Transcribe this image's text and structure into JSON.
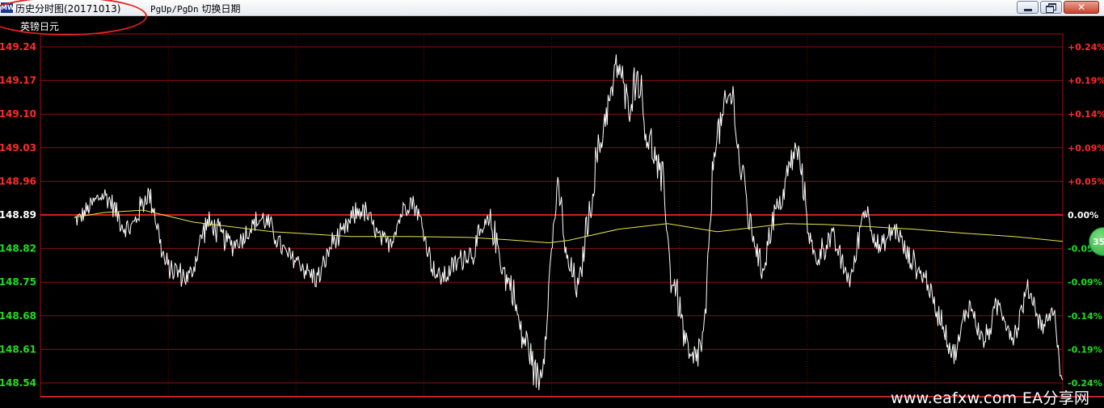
{
  "window": {
    "icon_label": "MW",
    "title": "历史分时图(20171013)",
    "hint_keys": "PgUp/PgDn",
    "hint_text": "切换日期",
    "minimize_icon": "minimize-icon",
    "restore_icon": "restore-icon",
    "close_label": "✕"
  },
  "symbol": "英镑日元",
  "colors": {
    "up": "#ff2a2a",
    "down": "#22dd22",
    "zero": "#ffffff",
    "grid": "#8b0000",
    "price": "#ffffff",
    "avg": "#e6e650"
  },
  "badge": {
    "label": "35"
  },
  "watermark": "www.eafxw.com  EA分享网",
  "chart_data": {
    "type": "line",
    "ylim": [
      148.52,
      149.26
    ],
    "base_price": 148.89,
    "y_ticks_left": [
      {
        "value": 149.24,
        "label": "149.24"
      },
      {
        "value": 149.17,
        "label": "149.17"
      },
      {
        "value": 149.1,
        "label": "149.10"
      },
      {
        "value": 149.03,
        "label": "149.03"
      },
      {
        "value": 148.96,
        "label": "148.96"
      },
      {
        "value": 148.89,
        "label": "148.89"
      },
      {
        "value": 148.82,
        "label": "148.82"
      },
      {
        "value": 148.75,
        "label": "148.75"
      },
      {
        "value": 148.68,
        "label": "148.68"
      },
      {
        "value": 148.61,
        "label": "148.61"
      },
      {
        "value": 148.54,
        "label": "148.54"
      }
    ],
    "y_ticks_right": [
      {
        "value": 149.24,
        "label": "+0.24%"
      },
      {
        "value": 149.17,
        "label": "+0.19%"
      },
      {
        "value": 149.1,
        "label": "+0.14%"
      },
      {
        "value": 149.03,
        "label": "+0.09%"
      },
      {
        "value": 148.96,
        "label": "+0.05%"
      },
      {
        "value": 148.89,
        "label": "0.00%"
      },
      {
        "value": 148.82,
        "label": "-0.05%"
      },
      {
        "value": 148.75,
        "label": "-0.09%"
      },
      {
        "value": 148.68,
        "label": "-0.14%"
      },
      {
        "value": 148.61,
        "label": "-0.19%"
      },
      {
        "value": 148.54,
        "label": "-0.24%"
      }
    ],
    "price": {
      "x": [
        0,
        0.03,
        0.055,
        0.075,
        0.095,
        0.115,
        0.135,
        0.16,
        0.19,
        0.22,
        0.245,
        0.265,
        0.29,
        0.315,
        0.34,
        0.37,
        0.4,
        0.42,
        0.44,
        0.455,
        0.47,
        0.49,
        0.5,
        0.51,
        0.52,
        0.53,
        0.54,
        0.55,
        0.56,
        0.57,
        0.58,
        0.595,
        0.605,
        0.625,
        0.635,
        0.65,
        0.665,
        0.675,
        0.685,
        0.695,
        0.71,
        0.73,
        0.75,
        0.765,
        0.785,
        0.8,
        0.815,
        0.83,
        0.845,
        0.86,
        0.875,
        0.89,
        0.905,
        0.92,
        0.935,
        0.95,
        0.965,
        0.98,
        0.99,
        1
      ],
      "y": [
        148.88,
        148.93,
        148.86,
        148.93,
        148.78,
        148.76,
        148.87,
        148.83,
        148.88,
        148.8,
        148.76,
        148.84,
        148.9,
        148.83,
        148.92,
        148.76,
        148.81,
        148.87,
        148.75,
        148.63,
        148.55,
        148.93,
        148.78,
        148.74,
        148.88,
        149.02,
        149.12,
        149.2,
        149.12,
        149.18,
        149.05,
        148.96,
        148.75,
        148.58,
        148.62,
        149.06,
        149.14,
        148.98,
        148.86,
        148.78,
        148.9,
        149.02,
        148.8,
        148.84,
        148.76,
        148.9,
        148.82,
        148.86,
        148.8,
        148.76,
        148.68,
        148.6,
        148.7,
        148.63,
        148.7,
        148.64,
        148.73,
        148.66,
        148.69,
        148.54
      ],
      "amp": [
        0.02,
        0.03,
        0.03,
        0.035,
        0.035,
        0.03,
        0.035,
        0.03,
        0.03,
        0.03,
        0.03,
        0.03,
        0.03,
        0.03,
        0.03,
        0.03,
        0.035,
        0.04,
        0.04,
        0.045,
        0.045,
        0.045,
        0.04,
        0.04,
        0.045,
        0.05,
        0.05,
        0.05,
        0.05,
        0.05,
        0.05,
        0.05,
        0.05,
        0.05,
        0.05,
        0.05,
        0.05,
        0.05,
        0.045,
        0.04,
        0.04,
        0.04,
        0.035,
        0.035,
        0.03,
        0.03,
        0.03,
        0.03,
        0.03,
        0.03,
        0.03,
        0.03,
        0.03,
        0.03,
        0.03,
        0.03,
        0.03,
        0.025,
        0.02,
        0.015
      ]
    },
    "average": {
      "x": [
        0,
        0.03,
        0.07,
        0.12,
        0.2,
        0.28,
        0.34,
        0.4,
        0.44,
        0.48,
        0.5,
        0.55,
        0.6,
        0.65,
        0.68,
        0.72,
        0.76,
        0.8,
        0.85,
        0.9,
        0.95,
        1
      ],
      "y": [
        148.885,
        148.895,
        148.9,
        148.875,
        148.855,
        148.845,
        148.845,
        148.843,
        148.838,
        148.832,
        148.837,
        148.86,
        148.872,
        148.855,
        148.862,
        148.872,
        148.87,
        148.866,
        148.86,
        148.852,
        148.845,
        148.835
      ]
    }
  }
}
